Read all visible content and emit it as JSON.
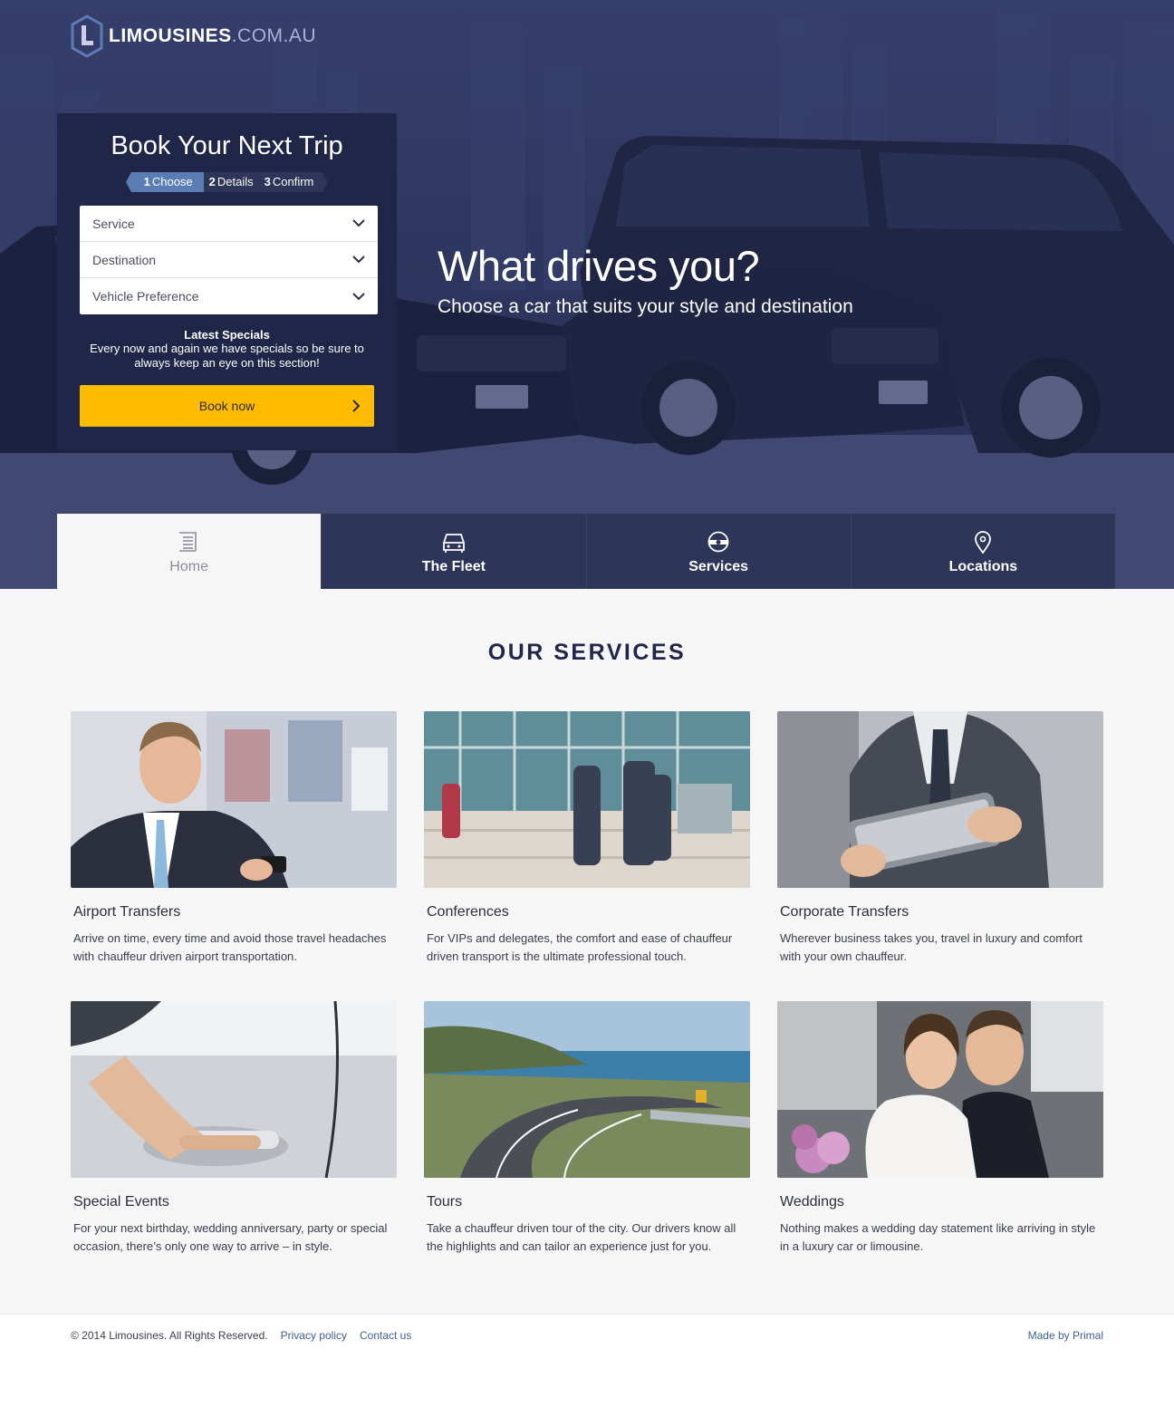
{
  "brand": {
    "name": "LIMOUSINES",
    "suffix": ".COM.AU"
  },
  "hero": {
    "title": "What drives you?",
    "subtitle": "Choose a car that suits your style and destination"
  },
  "booking": {
    "title": "Book Your Next Trip",
    "steps": [
      {
        "num": "1",
        "label": "Choose",
        "active": true
      },
      {
        "num": "2",
        "label": "Details",
        "active": false
      },
      {
        "num": "3",
        "label": "Confirm",
        "active": false
      }
    ],
    "selects": [
      {
        "selected": "Service"
      },
      {
        "selected": "Destination"
      },
      {
        "selected": "Vehicle Preference"
      }
    ],
    "specials_title": "Latest Specials",
    "specials_text": "Every now and again we have specials so be sure to always keep an eye on this section!",
    "button_label": "Book now"
  },
  "nav": {
    "items": [
      {
        "label": "Home",
        "icon": "list-icon",
        "active": true
      },
      {
        "label": "The Fleet",
        "icon": "car-icon",
        "active": false
      },
      {
        "label": "Services",
        "icon": "steering-wheel-icon",
        "active": false
      },
      {
        "label": "Locations",
        "icon": "map-pin-icon",
        "active": false
      }
    ]
  },
  "services": {
    "title": "OUR SERVICES",
    "items": [
      {
        "name": "Airport Transfers",
        "desc": "Arrive on time, every time and avoid those travel headaches with chauffeur driven airport transportation."
      },
      {
        "name": "Conferences",
        "desc": "For VIPs and delegates, the comfort and ease of chauffeur driven transport is the ultimate professional touch."
      },
      {
        "name": "Corporate Transfers",
        "desc": "Wherever business takes you, travel in luxury and comfort with your own chauffeur."
      },
      {
        "name": "Special Events",
        "desc": "For your next birthday, wedding anniversary, party or special occasion, there’s only one way to arrive – in style."
      },
      {
        "name": "Tours",
        "desc": "Take a chauffeur driven tour of the city. Our drivers know all the highlights and can tailor an experience just for you."
      },
      {
        "name": "Weddings",
        "desc": "Nothing makes a wedding day statement like arriving in style in a luxury car or limousine."
      }
    ]
  },
  "footer": {
    "copyright": "© 2014 Limousines. All Rights Reserved.",
    "privacy": "Privacy policy",
    "contact": "Contact us",
    "credit": "Made by Primal"
  },
  "colors": {
    "accent": "#ffbb00",
    "navy": "#1f2647",
    "nav_bg": "#2d3659",
    "step_active": "#5a7eb3",
    "link": "#3f5f92"
  }
}
